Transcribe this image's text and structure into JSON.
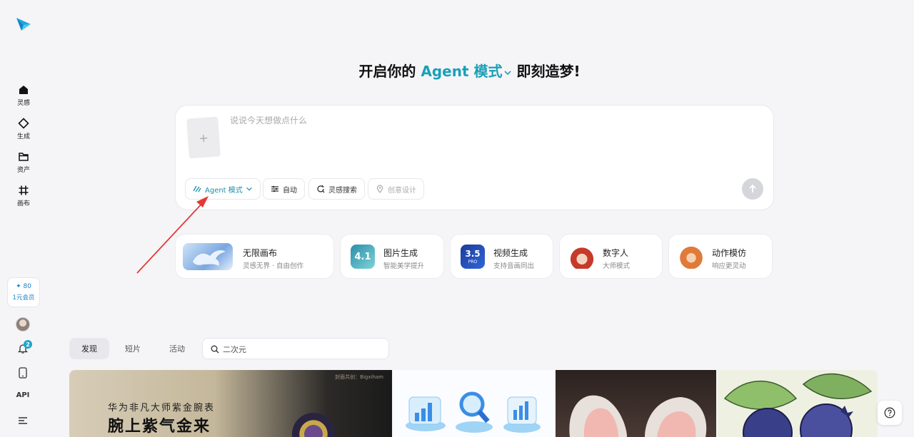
{
  "sidebar": {
    "items": [
      {
        "name": "inspiration",
        "label": "灵感",
        "icon": "home-icon"
      },
      {
        "name": "generate",
        "label": "生成",
        "icon": "diamond-icon"
      },
      {
        "name": "assets",
        "label": "资产",
        "icon": "folder-icon"
      },
      {
        "name": "canvas",
        "label": "画布",
        "icon": "hash-icon"
      }
    ],
    "credits": "80",
    "membership": "1元会员",
    "notification_count": "2",
    "api_label": "API"
  },
  "headline": {
    "prefix": "开启你的",
    "mode": "Agent 模式",
    "suffix": "即刻造梦!"
  },
  "prompt": {
    "placeholder": "说说今天想做点什么",
    "value": "",
    "upload_symbol": "+",
    "chips": {
      "agent": "Agent 模式",
      "auto": "自动",
      "search": "灵感搜索",
      "creative": "创意设计"
    }
  },
  "features": [
    {
      "title": "无限画布",
      "subtitle": "灵感无界 · 自由创作"
    },
    {
      "title": "图片生成",
      "subtitle": "智能美学提升",
      "badge": "4.1"
    },
    {
      "title": "视频生成",
      "subtitle": "支持音画同出",
      "badge": "3.5",
      "badge_sub": "PRO"
    },
    {
      "title": "数字人",
      "subtitle": "大师模式"
    },
    {
      "title": "动作模仿",
      "subtitle": "响应更灵动"
    }
  ],
  "tabs": [
    "发现",
    "短片",
    "活动"
  ],
  "search": {
    "placeholder": "二次元",
    "value": ""
  },
  "gallery": {
    "item1": {
      "credit": "封面共创：Bigxiham",
      "line1": "华为非凡大师紫金腕表",
      "line2": "腕上紫气金来"
    }
  },
  "colors": {
    "accent": "#1aa0b8",
    "link": "#1a7fc8",
    "arrow": "#e53935"
  }
}
